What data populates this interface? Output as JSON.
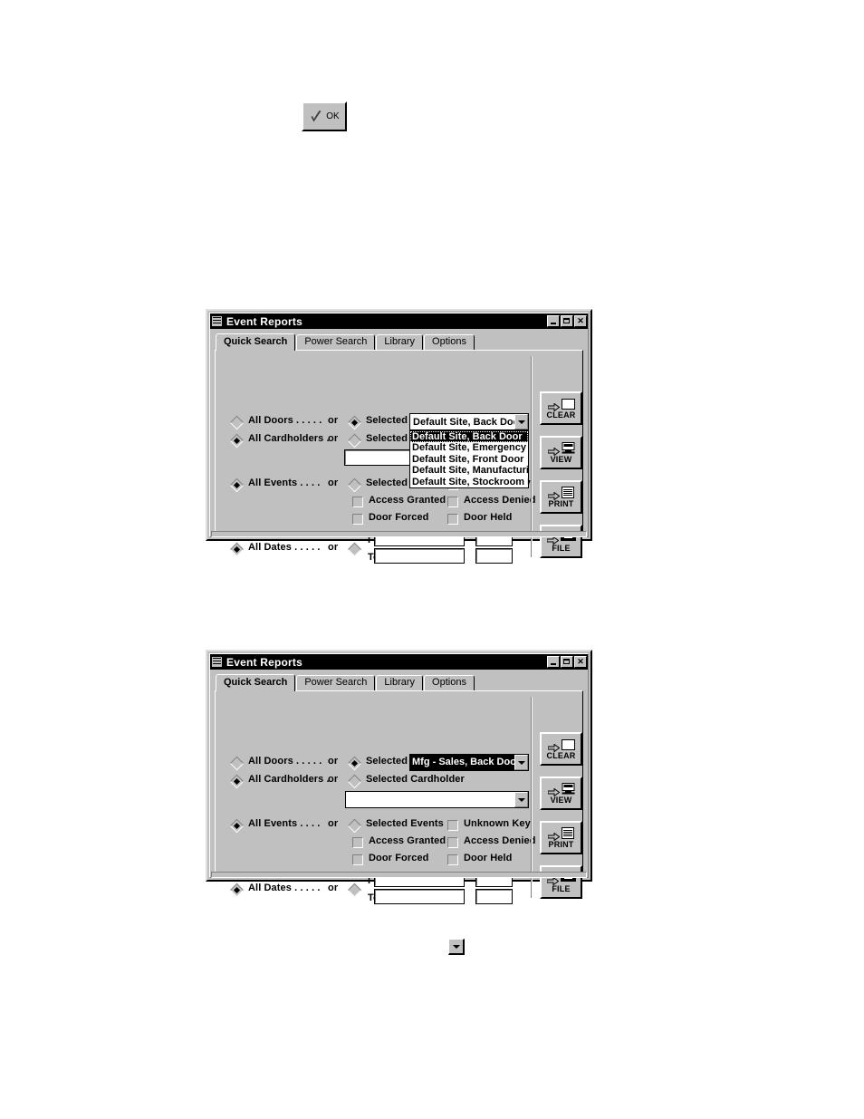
{
  "ok_button": {
    "label": "OK",
    "icon": "checkmark-icon"
  },
  "mini_dropdown": {
    "icon": "chevron-down-icon"
  },
  "window": {
    "title": "Event Reports",
    "icon": "application-icon",
    "controls": {
      "minimize": "minimize-icon",
      "maximize": "maximize-icon",
      "close": "✕"
    }
  },
  "tabs": [
    {
      "label": "Quick Search",
      "active": true
    },
    {
      "label": "Power Search",
      "active": false
    },
    {
      "label": "Library",
      "active": false
    },
    {
      "label": "Options",
      "active": false
    }
  ],
  "form": {
    "all_doors": "All Doors . . . . .",
    "or_1": "or",
    "selected_door": "Selected Door",
    "all_cardholders": "All Cardholders . ",
    "or_2": "or",
    "selected_cardholder": "Selected Cardholder",
    "all_events": "All Events . . . .",
    "or_3": "or",
    "selected_events": "Selected Events",
    "all_dates": "All Dates . . . . .",
    "or_4": "or",
    "from_label": "From",
    "to_label": "To",
    "checkboxes": [
      {
        "label": "Unknown Key",
        "checked": false
      },
      {
        "label": "Access Granted",
        "checked": false
      },
      {
        "label": "Access Denied",
        "checked": false
      },
      {
        "label": "Door Forced",
        "checked": false
      },
      {
        "label": "Door Held",
        "checked": false
      }
    ],
    "from_value": "",
    "from_time_value": "",
    "to_value": "",
    "to_time_value": "",
    "cardholder_value": ""
  },
  "action_buttons": [
    {
      "label": "CLEAR",
      "icon": "arrow-blank-page-icon"
    },
    {
      "label": "VIEW",
      "icon": "arrow-monitor-icon"
    },
    {
      "label": "PRINT",
      "icon": "arrow-document-icon"
    },
    {
      "label": "FILE",
      "icon": "arrow-disk-icon"
    }
  ],
  "dialog_1": {
    "door_combo_value": "Default Site, Back Door",
    "dropdown_open": true,
    "dropdown_items": [
      {
        "label": "Default Site, Back Door",
        "selected": true
      },
      {
        "label": "Default Site, Emergency Ex",
        "selected": false
      },
      {
        "label": "Default Site, Front Door",
        "selected": false
      },
      {
        "label": "Default Site, Manufacturing",
        "selected": false
      },
      {
        "label": "Default Site, Stockroom Do",
        "selected": false
      }
    ]
  },
  "dialog_2": {
    "door_combo_value": "Mfg - Sales, Back Door",
    "door_combo_highlighted": true,
    "dropdown_open": false
  },
  "colors": {
    "face": "#c0c0c0",
    "titlebar": "#000000",
    "titlebar_text": "#ffffff",
    "field": "#ffffff",
    "page": "#ffffff"
  }
}
